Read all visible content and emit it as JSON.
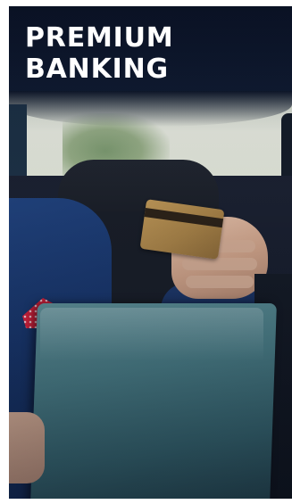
{
  "banner": {
    "headline_line1": "PREMIUM",
    "headline_line2": "BANKING",
    "photo_subject": "businessman-with-card-and-laptop-in-car",
    "colors": {
      "headline_text": "#ffffff",
      "background_dark": "#14233a"
    }
  }
}
